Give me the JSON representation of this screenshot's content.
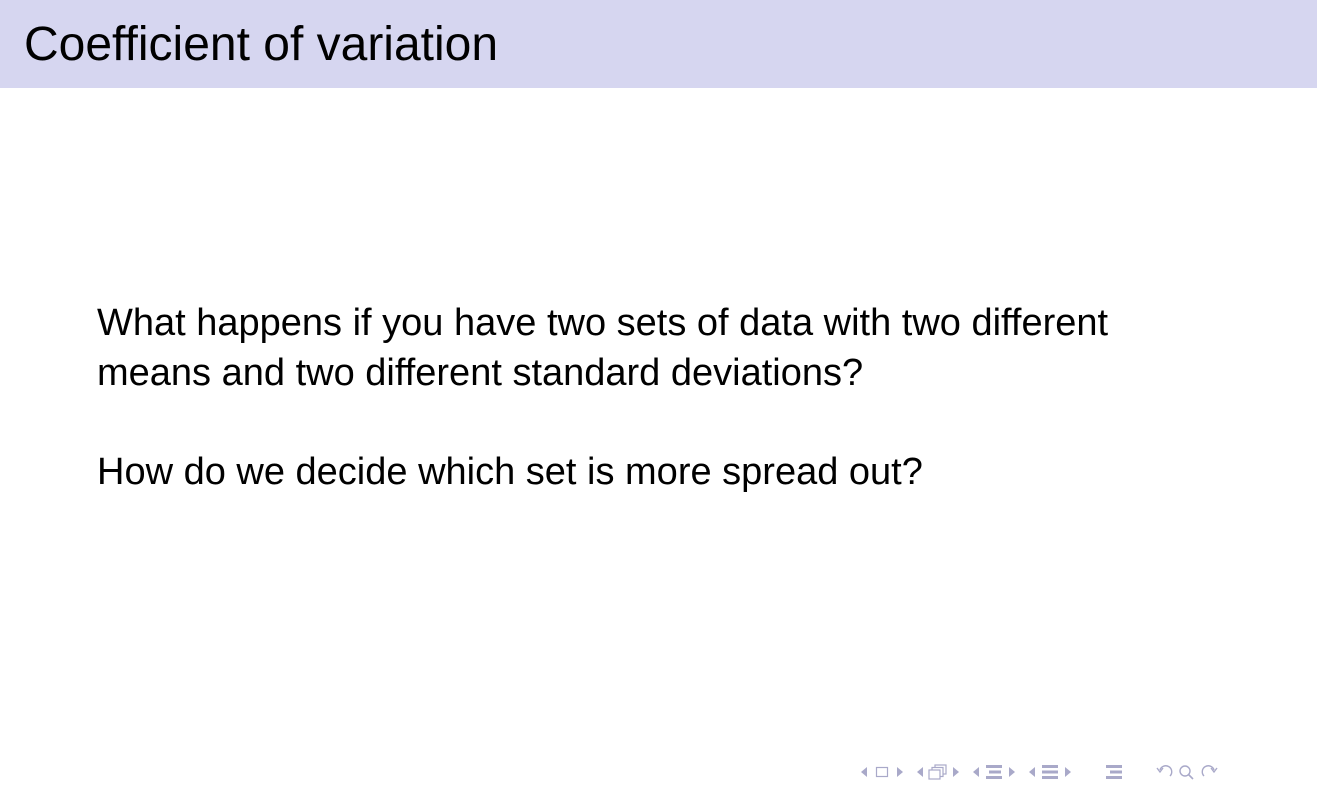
{
  "slide": {
    "title": "Coefficient of variation",
    "paragraphs": [
      "What happens if you have two sets of data with two different means and two different standard deviations?",
      "How do we decide which set is more spread out?"
    ]
  },
  "navigation": {
    "icons": [
      "previous-slide-icon",
      "slide-icon",
      "next-slide-icon",
      "previous-frame-icon",
      "frame-icon",
      "next-frame-icon",
      "previous-subsection-icon",
      "subsection-icon",
      "next-subsection-icon",
      "previous-section-icon",
      "section-icon",
      "next-section-icon",
      "appendix-icon",
      "back-icon",
      "search-icon",
      "forward-icon"
    ]
  },
  "colors": {
    "title_bar": "#d6d6f0",
    "nav": "#a9a9c9",
    "text": "#000000"
  }
}
